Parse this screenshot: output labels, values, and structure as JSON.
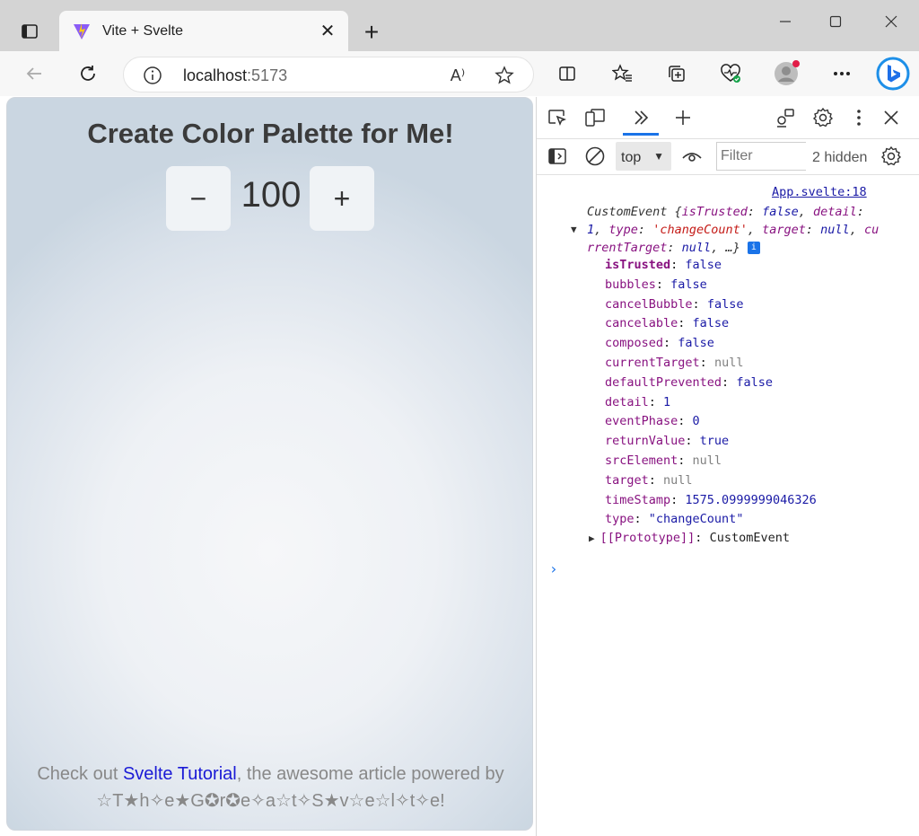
{
  "browser": {
    "tab_title": "Vite + Svelte",
    "tab_close": "✕",
    "new_tab": "+",
    "url_host": "localhost",
    "url_port": ":5173",
    "read_aloud": "A⁾"
  },
  "page": {
    "title": "Create Color Palette for Me!",
    "decrement_label": "−",
    "count_value": "100",
    "increment_label": "+",
    "footer_prefix": "Check out ",
    "footer_link": "Svelte Tutorial",
    "footer_suffix": ", the awesome article powered by",
    "footer_decorated": "☆T★h✧e★G✪r✪e✧a☆t✧S★v☆e☆l✧t✧e!"
  },
  "devtools": {
    "context_label": "top",
    "filter_placeholder": "Filter",
    "hidden_count": "2 hidden",
    "console": {
      "source_link": "App.svelte:18",
      "summary_prefix": "CustomEvent {",
      "summary_parts": [
        {
          "k": "isTrusted",
          "v": "false",
          "t": "bool"
        },
        {
          "k": "detail",
          "v": "1",
          "t": "bool"
        },
        {
          "k": "type",
          "v": "'changeCount'",
          "t": "str"
        },
        {
          "k": "target",
          "v": "null",
          "t": "bool"
        },
        {
          "k": "currentTarget",
          "v": "null",
          "t": "bool"
        }
      ],
      "summary_suffix": ", …}",
      "info_badge": "i",
      "properties": [
        {
          "key": "isTrusted",
          "value": "false",
          "type": "bool",
          "bold": true
        },
        {
          "key": "bubbles",
          "value": "false",
          "type": "bool",
          "bold": false
        },
        {
          "key": "cancelBubble",
          "value": "false",
          "type": "bool",
          "bold": false
        },
        {
          "key": "cancelable",
          "value": "false",
          "type": "bool",
          "bold": false
        },
        {
          "key": "composed",
          "value": "false",
          "type": "bool",
          "bold": false
        },
        {
          "key": "currentTarget",
          "value": "null",
          "type": "null",
          "bold": false
        },
        {
          "key": "defaultPrevented",
          "value": "false",
          "type": "bool",
          "bold": false
        },
        {
          "key": "detail",
          "value": "1",
          "type": "num",
          "bold": false
        },
        {
          "key": "eventPhase",
          "value": "0",
          "type": "num",
          "bold": false
        },
        {
          "key": "returnValue",
          "value": "true",
          "type": "bool",
          "bold": false
        },
        {
          "key": "srcElement",
          "value": "null",
          "type": "null",
          "bold": false
        },
        {
          "key": "target",
          "value": "null",
          "type": "null",
          "bold": false
        },
        {
          "key": "timeStamp",
          "value": "1575.0999999046326",
          "type": "num",
          "bold": false
        },
        {
          "key": "type",
          "value": "\"changeCount\"",
          "type": "str",
          "bold": false
        }
      ],
      "prototype_key": "[[Prototype]]",
      "prototype_value": "CustomEvent",
      "prompt": "›"
    }
  },
  "colors": {
    "accent": "#1a73e8",
    "link": "#1a1ad6",
    "console_key": "#881280",
    "console_value": "#1a1aa6"
  }
}
